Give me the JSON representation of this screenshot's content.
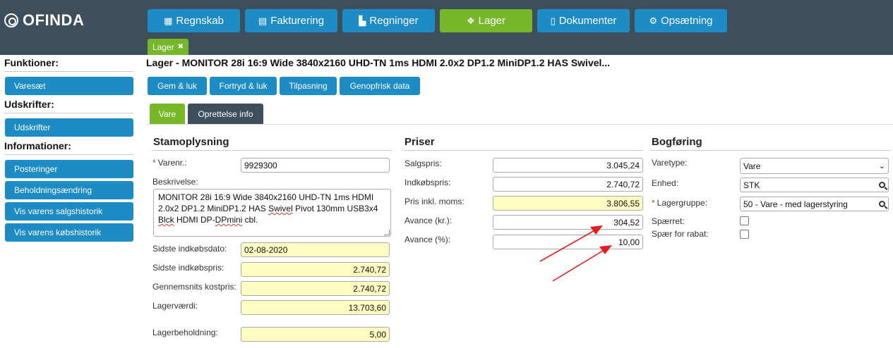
{
  "app": {
    "logo": "OFINDA"
  },
  "nav": [
    {
      "label": "Regnskab",
      "icon": "calendar-icon",
      "glyph": "▦"
    },
    {
      "label": "Fakturering",
      "icon": "clipboard-icon",
      "glyph": "▤"
    },
    {
      "label": "Regninger",
      "icon": "industry-icon",
      "glyph": "▙"
    },
    {
      "label": "Lager",
      "icon": "cubes-icon",
      "glyph": "❖"
    },
    {
      "label": "Dokumenter",
      "icon": "file-icon",
      "glyph": "▯"
    },
    {
      "label": "Opsætning",
      "icon": "gear-icon",
      "glyph": "⚙"
    }
  ],
  "subtab": {
    "label": "Lager",
    "close": "✖"
  },
  "sidebar": {
    "funktioner": "Funktioner:",
    "varesaet": "Varesæt",
    "udskrifter_head": "Udskrifter:",
    "udskrifter": "Udskrifter",
    "informationer": "Informationer:",
    "posteringer": "Posteringer",
    "beholdning": "Beholdningsændring",
    "salgshistorik": "Vis varens salgshistorik",
    "kobshistorik": "Vis varens købshistorik"
  },
  "page": {
    "title": "Lager - MONITOR 28i 16:9 Wide 3840x2160 UHD-TN 1ms HDMI 2.0x2 DP1.2 MiniDP1.2 HAS Swivel..."
  },
  "toolbar": {
    "save": "Gem & luk",
    "undo": "Fortryd & luk",
    "adjust": "Tilpasning",
    "refresh": "Genopfrisk data"
  },
  "tabs": {
    "vare": "Vare",
    "info": "Oprettelse info"
  },
  "stamop": {
    "title": "Stamoplysning",
    "req": "*",
    "varenr_label": "Varenr.:",
    "varenr": "9929300",
    "beskrivelse_label": "Beskrivelse:",
    "desc_line1": "MONITOR 28i 16:9 Wide 3840x2160 UHD-TN 1ms HDMI",
    "desc_line2a": "2.0x2 DP1.2 MiniDP1.2 HAS ",
    "desc_line2b": "Swivel",
    "desc_line2c": " Pivot 130mm USB3x4",
    "desc_line3a": "Blck",
    "desc_line3b": " HDMI DP-",
    "desc_line3c": "DPmini",
    "desc_line3d": " cbl.",
    "sidste_dato_label": "Sidste indkøbsdato:",
    "sidste_dato": "02-08-2020",
    "sidste_pris_label": "Sidste indkøbspris:",
    "sidste_pris": "2.740,72",
    "gns_label": "Gennemsnits kostpris:",
    "gns": "2.740,72",
    "lagervaerdi_label": "Lagerværdi:",
    "lagervaerdi": "13.703,60",
    "beholdning_label": "Lagerbeholdning:",
    "beholdning": "5,00"
  },
  "priser": {
    "title": "Priser",
    "salgspris_label": "Salgspris:",
    "salgspris": "3.045,24",
    "indkob_label": "Indkøbspris:",
    "indkob": "2.740,72",
    "moms_label": "Pris inkl. moms:",
    "moms": "3.806,55",
    "avance_kr_label": "Avance (kr.):",
    "avance_kr": "304,52",
    "avance_pct_label": "Avance (%):",
    "avance_pct": "10,00"
  },
  "bogforing": {
    "title": "Bogføring",
    "req": "*",
    "varetype_label": "Varetype:",
    "varetype": "Vare",
    "enhed_label": "Enhed:",
    "enhed": "STK",
    "lagergruppe_label": "Lagergruppe:",
    "lagergruppe": "50 - Vare - med lagerstyring",
    "spaerret_label": "Spærret:",
    "rabat_label": "Spær for rabat:"
  },
  "colors": {
    "header": "#3d4f5c",
    "primary": "#1d8bc4",
    "active": "#76b82a",
    "highlight": "#fffdc2",
    "arrow": "#e02020"
  }
}
